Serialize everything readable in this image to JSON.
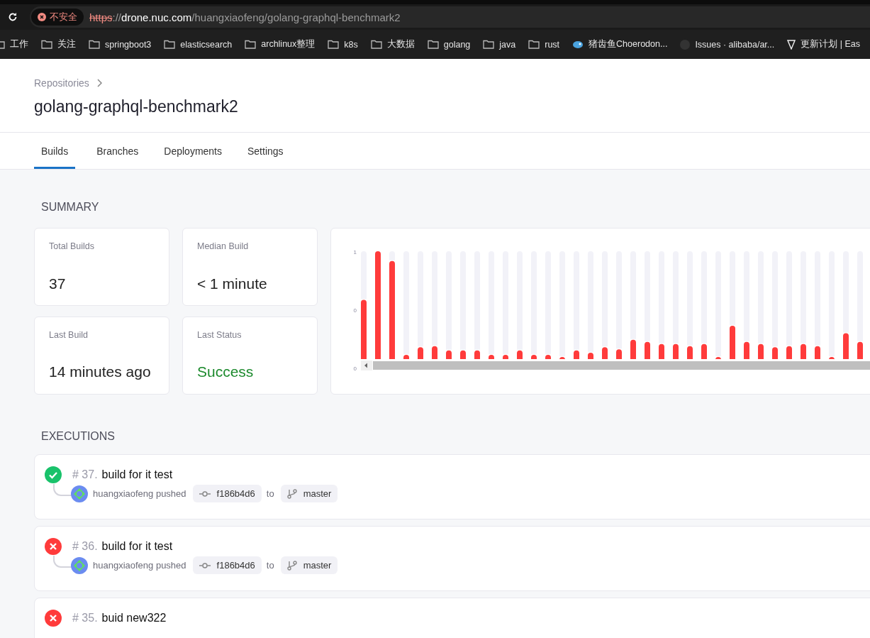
{
  "browser": {
    "security_label": "不安全",
    "url": {
      "scheme": "https",
      "separator": "://",
      "host": "drone.nuc.com",
      "path": "/huangxiaofeng/golang-graphql-benchmark2"
    },
    "bookmarks": [
      {
        "kind": "folder",
        "label": "工作"
      },
      {
        "kind": "folder",
        "label": "关注"
      },
      {
        "kind": "folder",
        "label": "springboot3"
      },
      {
        "kind": "folder",
        "label": "elasticsearch"
      },
      {
        "kind": "folder",
        "label": "archlinux整理"
      },
      {
        "kind": "folder",
        "label": "k8s"
      },
      {
        "kind": "folder",
        "label": "大数据"
      },
      {
        "kind": "folder",
        "label": "golang"
      },
      {
        "kind": "folder",
        "label": "java"
      },
      {
        "kind": "folder",
        "label": "rust"
      },
      {
        "kind": "fish",
        "label": "猪齿鱼Choerodon..."
      },
      {
        "kind": "github",
        "label": "Issues · alibaba/ar..."
      },
      {
        "kind": "site",
        "label": "更新计划 | Eas"
      }
    ]
  },
  "breadcrumb": "Repositories",
  "title": "golang-graphql-benchmark2",
  "tabs": [
    {
      "label": "Builds",
      "selected": true
    },
    {
      "label": "Branches",
      "selected": false
    },
    {
      "label": "Deployments",
      "selected": false
    },
    {
      "label": "Settings",
      "selected": false
    }
  ],
  "summary": {
    "heading": "SUMMARY",
    "stats": [
      {
        "label": "Total Builds",
        "value": "37",
        "kind": "plain"
      },
      {
        "label": "Median Build",
        "value": "< 1 minute",
        "kind": "plain"
      },
      {
        "label": "Last Build",
        "value": "14 minutes ago",
        "kind": "plain"
      },
      {
        "label": "Last Status",
        "value": "Success",
        "kind": "success"
      }
    ],
    "chart_axis_labels": [
      "1",
      "0",
      "0"
    ]
  },
  "executions": {
    "heading": "EXECUTIONS",
    "items": [
      {
        "kind": "success",
        "number": "# 37.",
        "title": "build for it test",
        "author": "huangxiaofeng pushed",
        "commit": "f186b4d6",
        "to": "to",
        "branch": "master"
      },
      {
        "kind": "failure",
        "number": "# 36.",
        "title": "build for it test",
        "author": "huangxiaofeng pushed",
        "commit": "f186b4d6",
        "to": "to",
        "branch": "master"
      },
      {
        "kind": "failure",
        "number": "# 35.",
        "title": "buid new322"
      }
    ]
  }
}
